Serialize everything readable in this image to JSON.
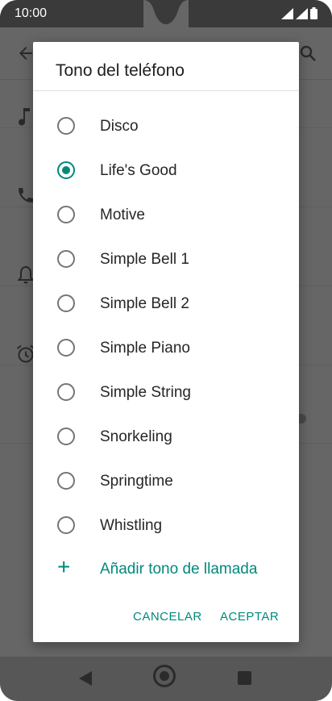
{
  "status_bar": {
    "time": "10:00"
  },
  "dialog": {
    "title": "Tono del teléfono",
    "options": [
      {
        "label": "Disco",
        "selected": false
      },
      {
        "label": "Life's Good",
        "selected": true
      },
      {
        "label": "Motive",
        "selected": false
      },
      {
        "label": "Simple Bell 1",
        "selected": false
      },
      {
        "label": "Simple Bell 2",
        "selected": false
      },
      {
        "label": "Simple Piano",
        "selected": false
      },
      {
        "label": "Simple String",
        "selected": false
      },
      {
        "label": "Snorkeling",
        "selected": false
      },
      {
        "label": "Springtime",
        "selected": false
      },
      {
        "label": "Whistling",
        "selected": false
      }
    ],
    "add_ringtone_label": "Añadir tono de llamada",
    "cancel_label": "CANCELAR",
    "accept_label": "ACEPTAR"
  },
  "colors": {
    "accent": "#00897b",
    "scrim": "#666666"
  },
  "icons": {
    "back": "arrow-left-icon",
    "search": "search-icon",
    "music": "music-note-icon",
    "phone": "phone-icon",
    "bell": "bell-icon",
    "alarm": "alarm-clock-icon",
    "add": "plus-icon"
  }
}
